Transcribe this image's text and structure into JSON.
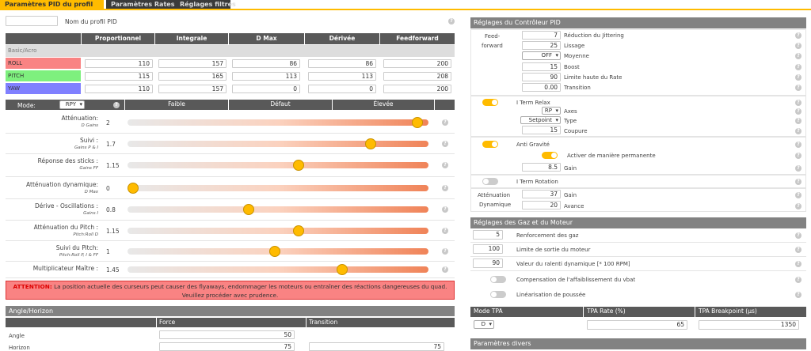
{
  "tabs": [
    "Paramètres PID du profil",
    "Paramètres Rates du profil",
    "Réglages filtres"
  ],
  "profile": {
    "name_label": "Nom du profil PID",
    "name_value": ""
  },
  "pid": {
    "columns": [
      "Proportionnel",
      "Integrale",
      "D Max",
      "Dérivée",
      "Feedforward"
    ],
    "group": "Basic/Acro",
    "rows": [
      {
        "name": "ROLL",
        "color": "#f98383",
        "values": [
          "110",
          "157",
          "86",
          "86",
          "200"
        ]
      },
      {
        "name": "PITCH",
        "color": "#7ef07e",
        "values": [
          "115",
          "165",
          "113",
          "113",
          "208"
        ]
      },
      {
        "name": "YAW",
        "color": "#8080ff",
        "values": [
          "110",
          "157",
          "0",
          "0",
          "200"
        ]
      }
    ]
  },
  "sliders": {
    "mode_label": "Mode:",
    "mode_value": "RPY",
    "scale": [
      "Faible",
      "Défaut",
      "Élevée"
    ],
    "rows": [
      {
        "title": "Atténuation:",
        "sub": "D Gains",
        "value": "2",
        "pos": 0.98
      },
      {
        "title": "Suivi :",
        "sub": "Gains P & I",
        "value": "1.7",
        "pos": 0.82
      },
      {
        "title": "Réponse des sticks :",
        "sub": "Gains FF",
        "value": "1.15",
        "pos": 0.57
      },
      {
        "title": "Atténuation dynamique:",
        "sub": "D Max",
        "value": "0",
        "pos": 0.0
      },
      {
        "title": "Dérive - Oscillations :",
        "sub": "Gains I",
        "value": "0.8",
        "pos": 0.4
      },
      {
        "title": "Atténuation du Pitch :",
        "sub": "Pitch:Roll D",
        "value": "1.15",
        "pos": 0.57
      },
      {
        "title": "Suivi du Pitch:",
        "sub": "Pitch:Roll P, I & FF",
        "value": "1",
        "pos": 0.49
      },
      {
        "title": "Multiplicateur Maître :",
        "sub": "",
        "value": "1.45",
        "pos": 0.72
      }
    ]
  },
  "warning": {
    "bold": "ATTENTION:",
    "text": "La position actuelle des curseurs peut causer des flyaways, endommager les moteurs ou entraîner des réactions dangereuses du quad. Veuillez procéder avec prudence."
  },
  "angle": {
    "title": "Angle/Horizon",
    "col_force": "Force",
    "col_transition": "Transition",
    "rows": [
      {
        "name": "Angle",
        "force": "50",
        "transition": ""
      },
      {
        "name": "Horizon",
        "force": "75",
        "transition": "75"
      }
    ]
  },
  "controller": {
    "title": "Réglages du Contrôleur PID",
    "ff_label_1": "Feed-",
    "ff_label_2": "forward",
    "ff_rows": [
      {
        "value": "7",
        "label": "Réduction du Jittering",
        "kind": "input"
      },
      {
        "value": "25",
        "label": "Lissage",
        "kind": "input"
      },
      {
        "value": "OFF",
        "label": "Moyenne",
        "kind": "select"
      },
      {
        "value": "15",
        "label": "Boost",
        "kind": "input"
      },
      {
        "value": "90",
        "label": "Limite haute du Rate",
        "kind": "input"
      },
      {
        "value": "0.00",
        "label": "Transition",
        "kind": "input"
      }
    ],
    "iterm_relax": {
      "label": "I Term Relax",
      "axes_value": "RP",
      "axes_label": "Axes",
      "type_value": "Setpoint",
      "type_label": "Type",
      "cutoff_value": "15",
      "cutoff_label": "Coupure"
    },
    "anti_gravity": {
      "label": "Anti Gravité",
      "permanent_label": "Activer de manière permanente",
      "gain_value": "8.5",
      "gain_label": "Gain"
    },
    "iterm_rotation": {
      "label": "I Term Rotation"
    },
    "dyn_att": {
      "label_1": "Atténuation",
      "label_2": "Dynamique",
      "gain_value": "37",
      "gain_label": "Gain",
      "advance_value": "20",
      "advance_label": "Avance"
    }
  },
  "throttle": {
    "title": "Réglages des Gaz et du Moteur",
    "rows": [
      {
        "value": "5",
        "label": "Renforcement des gaz"
      },
      {
        "value": "100",
        "label": "Limite de sortie du moteur"
      },
      {
        "value": "90",
        "label": "Valeur du ralenti dynamique [* 100 RPM]"
      }
    ],
    "toggles": [
      "Compensation de l'affaiblissement du vbat",
      "Linéarisation de poussée"
    ]
  },
  "tpa": {
    "col_mode": "Mode TPA",
    "col_rate": "TPA Rate (%)",
    "col_bp": "TPA Breakpoint (µs)",
    "mode": "D",
    "rate": "65",
    "bp": "1350"
  },
  "misc": {
    "title": "Paramètres divers"
  },
  "help_glyph": "?"
}
